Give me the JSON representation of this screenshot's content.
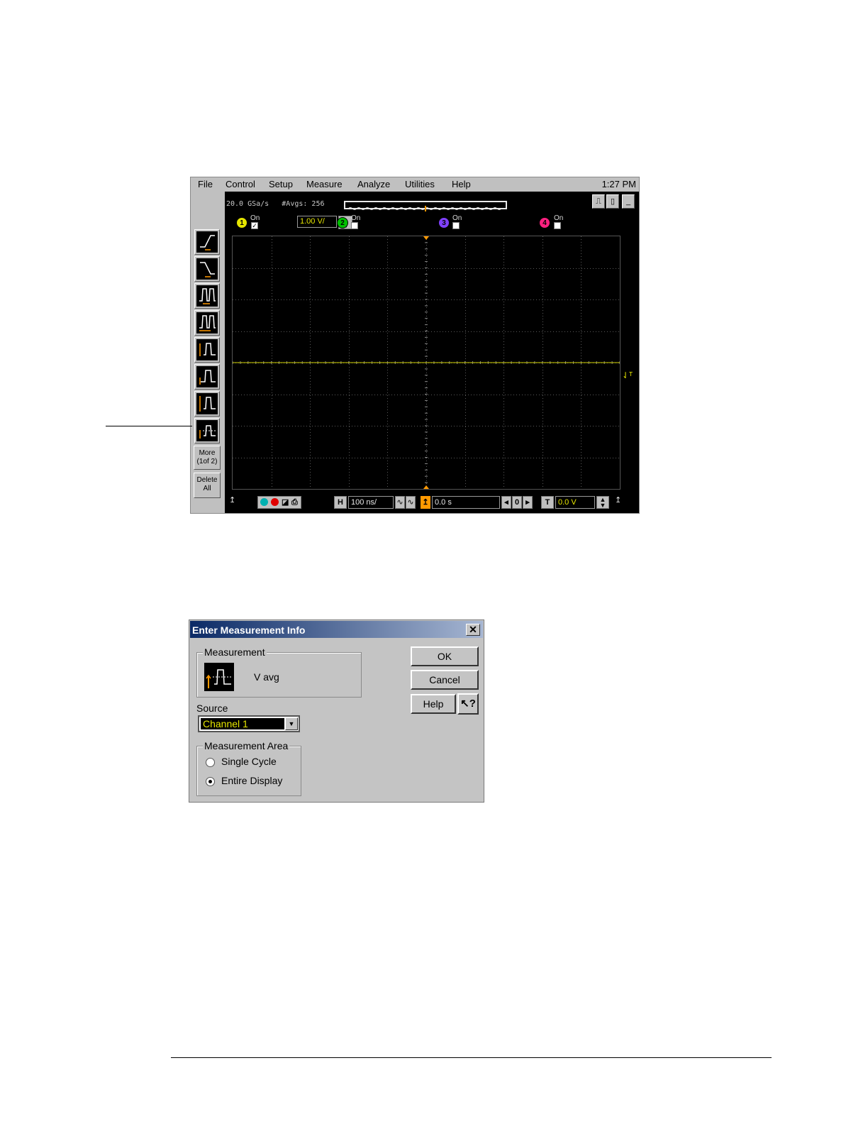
{
  "scope": {
    "menu": [
      "File",
      "Control",
      "Setup",
      "Measure",
      "Analyze",
      "Utilities",
      "Help"
    ],
    "clock": "1:27 PM",
    "sample_rate": "20.0 GSa/s",
    "averages": "#Avgs: 256",
    "left_toolbar": {
      "measurement_icons": [
        "rise-time-icon",
        "fall-time-icon",
        "period-icon",
        "frequency-icon",
        "v-amplitude-icon",
        "v-top-icon",
        "v-max-icon",
        "v-avg-icon"
      ],
      "more_label_1": "More",
      "more_label_2": "(1of 2)",
      "delete_label_1": "Delete",
      "delete_label_2": "All"
    },
    "channels": [
      {
        "number": "1",
        "on_label": "On",
        "checked": true,
        "color": "#e6e600",
        "scale": "1.00 V/"
      },
      {
        "number": "2",
        "on_label": "On",
        "checked": false,
        "color": "#00c000"
      },
      {
        "number": "3",
        "on_label": "On",
        "checked": false,
        "color": "#8040ff"
      },
      {
        "number": "4",
        "on_label": "On",
        "checked": false,
        "color": "#ff2080"
      }
    ],
    "bottom": {
      "h_label": "H",
      "timebase": "100 ns/",
      "delay": "0.0 s",
      "t_label": "T",
      "trigger_level": "0.0 V"
    },
    "trace_color": "#d0d000",
    "marker_color": "#ff9900"
  },
  "dialog": {
    "title": "Enter Measurement Info",
    "close_glyph": "✕",
    "measurement_group": "Measurement",
    "measurement_name": "V avg",
    "source_label": "Source",
    "source_value": "Channel 1",
    "area_group": "Measurement Area",
    "options": [
      "Single Cycle",
      "Entire Display"
    ],
    "selected_option": "Entire Display",
    "buttons": {
      "ok": "OK",
      "cancel": "Cancel",
      "help": "Help",
      "whats_this": "?"
    }
  }
}
